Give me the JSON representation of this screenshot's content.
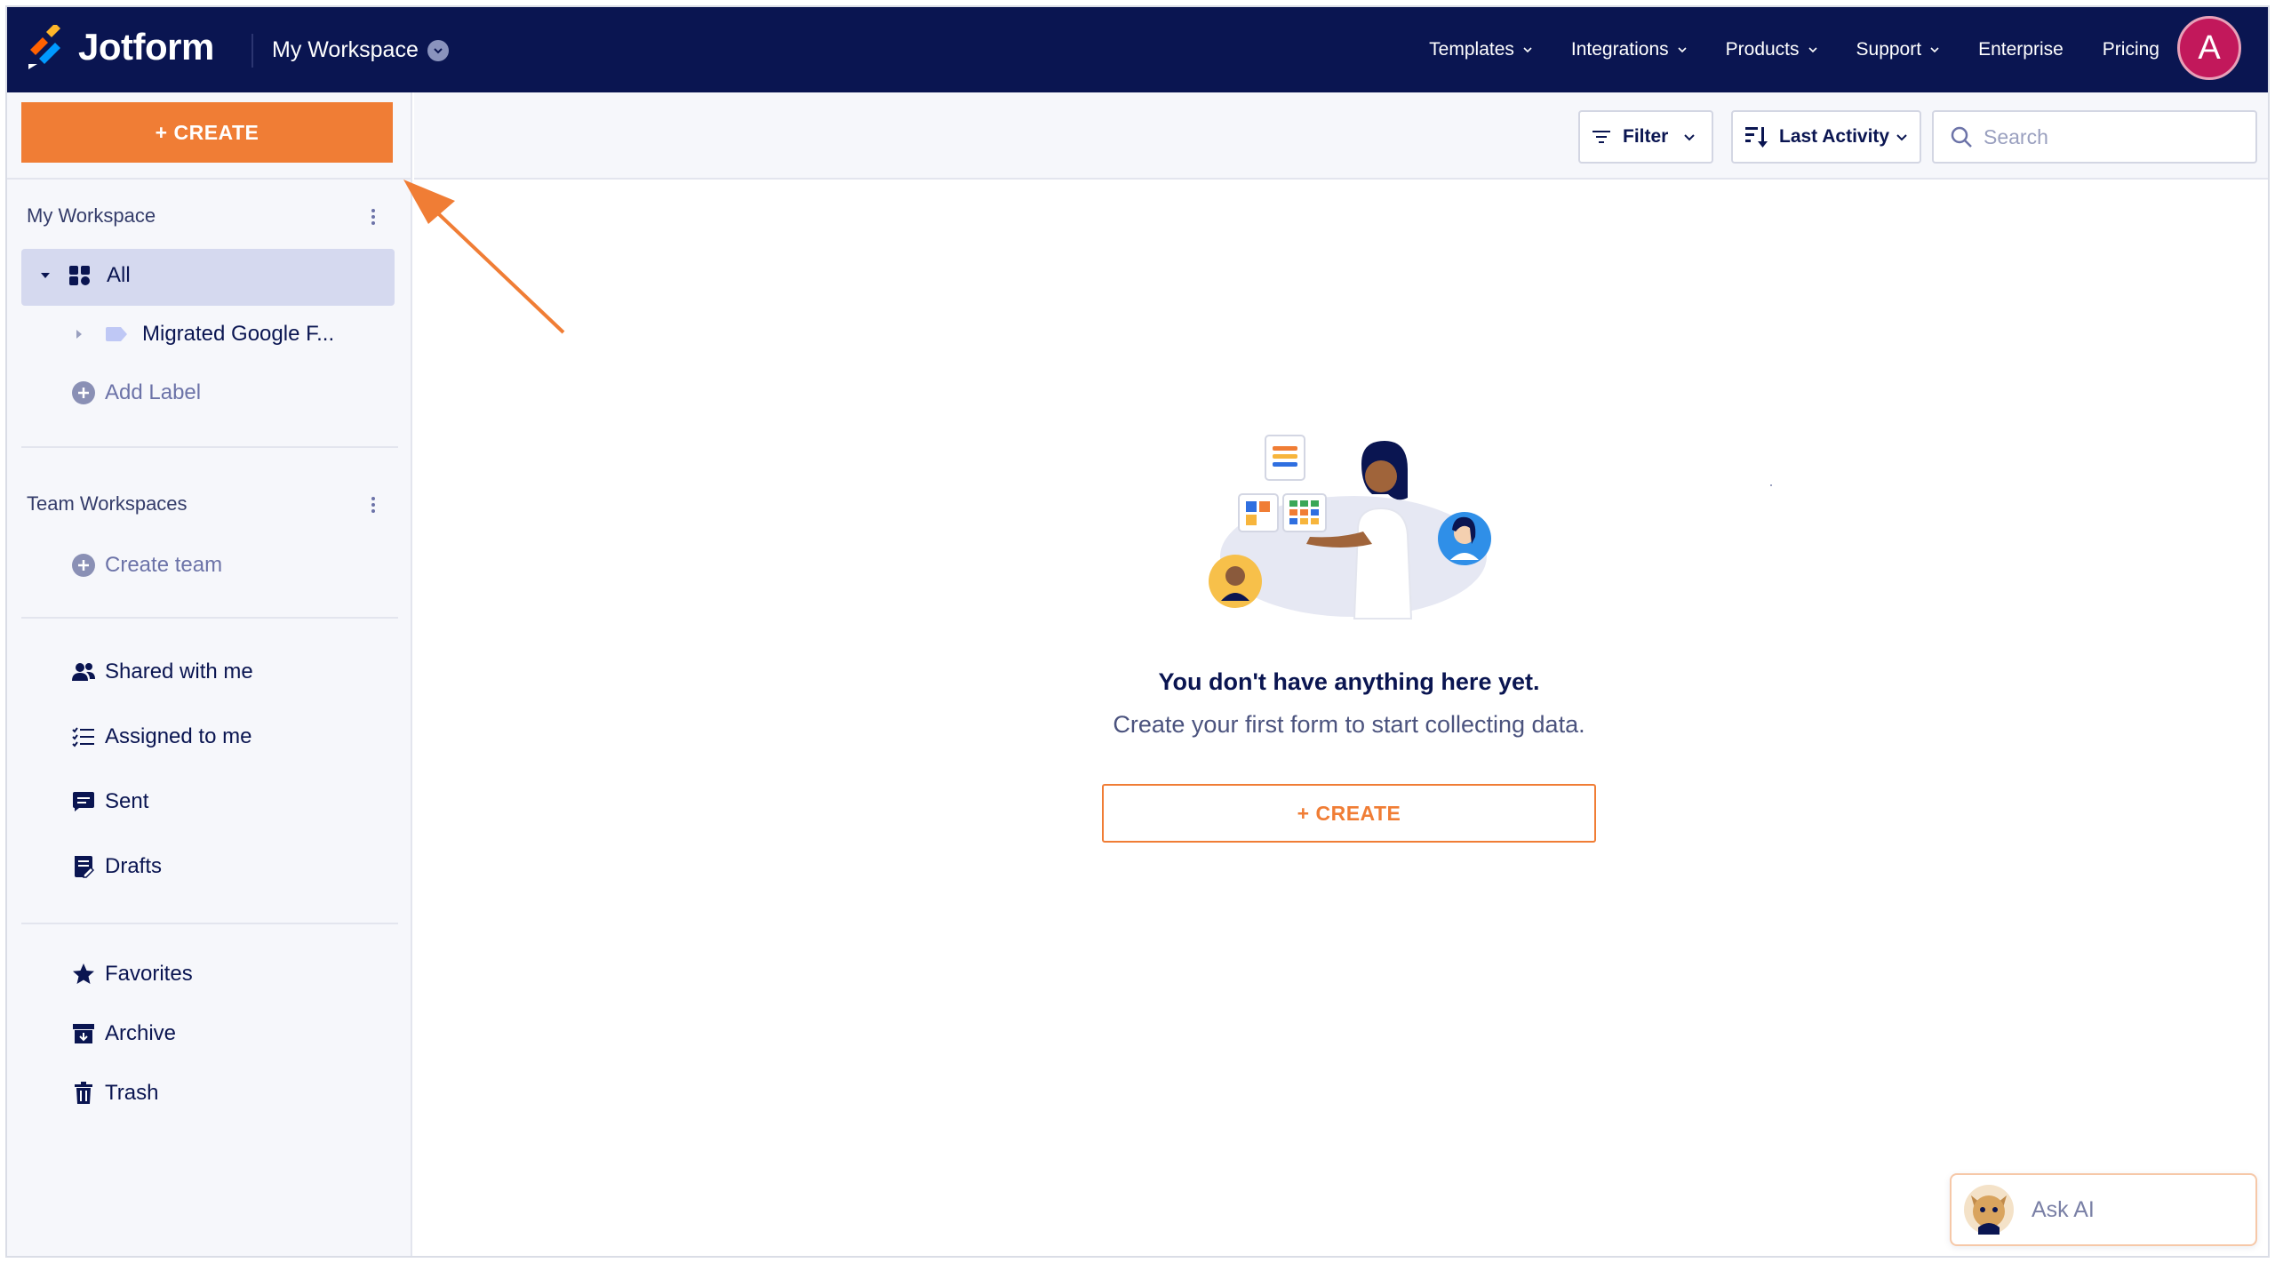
{
  "app": {
    "brand": "Jotform",
    "workspace_title": "My Workspace"
  },
  "nav": {
    "links": [
      {
        "label": "Templates",
        "dropdown": true
      },
      {
        "label": "Integrations",
        "dropdown": true
      },
      {
        "label": "Products",
        "dropdown": true
      },
      {
        "label": "Support",
        "dropdown": true
      },
      {
        "label": "Enterprise",
        "dropdown": false
      },
      {
        "label": "Pricing",
        "dropdown": false
      }
    ],
    "avatar_initial": "A"
  },
  "sidebar": {
    "create_label": "+ CREATE",
    "my_workspace_heading": "My Workspace",
    "all_label": "All",
    "folder_label": "Migrated Google F...",
    "add_label": "Add Label",
    "team_heading": "Team Workspaces",
    "create_team": "Create team",
    "items_group1": [
      {
        "label": "Shared with me",
        "icon": "people-icon"
      },
      {
        "label": "Assigned to me",
        "icon": "checklist-icon"
      },
      {
        "label": "Sent",
        "icon": "message-icon"
      },
      {
        "label": "Drafts",
        "icon": "draft-icon"
      }
    ],
    "items_group2": [
      {
        "label": "Favorites",
        "icon": "star-icon"
      },
      {
        "label": "Archive",
        "icon": "archive-icon"
      },
      {
        "label": "Trash",
        "icon": "trash-icon"
      }
    ]
  },
  "toolbar": {
    "filter_label": "Filter",
    "sort_label": "Last Activity",
    "search_placeholder": "Search"
  },
  "empty_state": {
    "title": "You don't have anything here yet.",
    "subtitle": "Create your first form to start collecting data.",
    "create_label": "+ CREATE"
  },
  "ask_ai": {
    "label": "Ask AI"
  },
  "colors": {
    "navy": "#0a1551",
    "orange": "#f07d35",
    "sidebar_bg": "#f6f7fb",
    "selected_bg": "#d5d9ef",
    "avatar": "#c2185b"
  }
}
